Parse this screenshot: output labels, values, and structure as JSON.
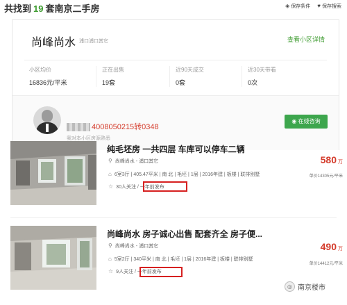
{
  "header": {
    "prefix": "共找到",
    "count": "19",
    "suffix": "套南京二手房",
    "save_condition": "保存条件",
    "save_search": "保存搜索"
  },
  "community": {
    "name": "尚峰尚水",
    "district": "浦口浦口其它",
    "detail_link": "查看小区详情",
    "stats": [
      {
        "label": "小区均价",
        "value": "16836元/平米"
      },
      {
        "label": "正在出售",
        "value": "19套"
      },
      {
        "label": "近90天成交",
        "value": "0套"
      },
      {
        "label": "近30天带看",
        "value": "0次"
      }
    ],
    "agent": {
      "phone": "4008050215转0348",
      "subtitle": "我对本小区房源熟悉",
      "consult_button": "在线咨询"
    }
  },
  "listings": [
    {
      "title": "纯毛坯房 一共四层 车库可以停车二辆",
      "community": "尚峰尚水",
      "district": "浦口其它",
      "details": "6室3厅 | 405.47平米 | 南 北 | 毛坯 | 1层 | 2016年建 | 板楼 | 联排别墅",
      "followers": "30人关注",
      "published": "一年前发布",
      "price": "580",
      "price_unit": "万",
      "unit_price": "单价14305元/平米"
    },
    {
      "title": "尚峰尚水 房子诚心出售 配套齐全 房子便...",
      "community": "尚峰尚水",
      "district": "浦口其它",
      "details": "5室2厅 | 340平米 | 南 北 | 毛坯 | 1层 | 2016年建 | 板楼 | 联排别墅",
      "followers": "9人关注",
      "published": "一年前发布",
      "price": "490",
      "price_unit": "万",
      "unit_price": "单价14412元/平米"
    }
  ],
  "watermark": "南京楼市",
  "icons": {
    "save_condition": "pin-icon",
    "save_search": "heart-icon",
    "location": "location-pin-icon",
    "house": "house-icon",
    "star": "star-icon",
    "chat": "chat-icon"
  },
  "colors": {
    "accent_green": "#3d9b2f",
    "price_red": "#d43b2b",
    "button_green": "#3da64d",
    "highlight_box": "#d62020"
  }
}
